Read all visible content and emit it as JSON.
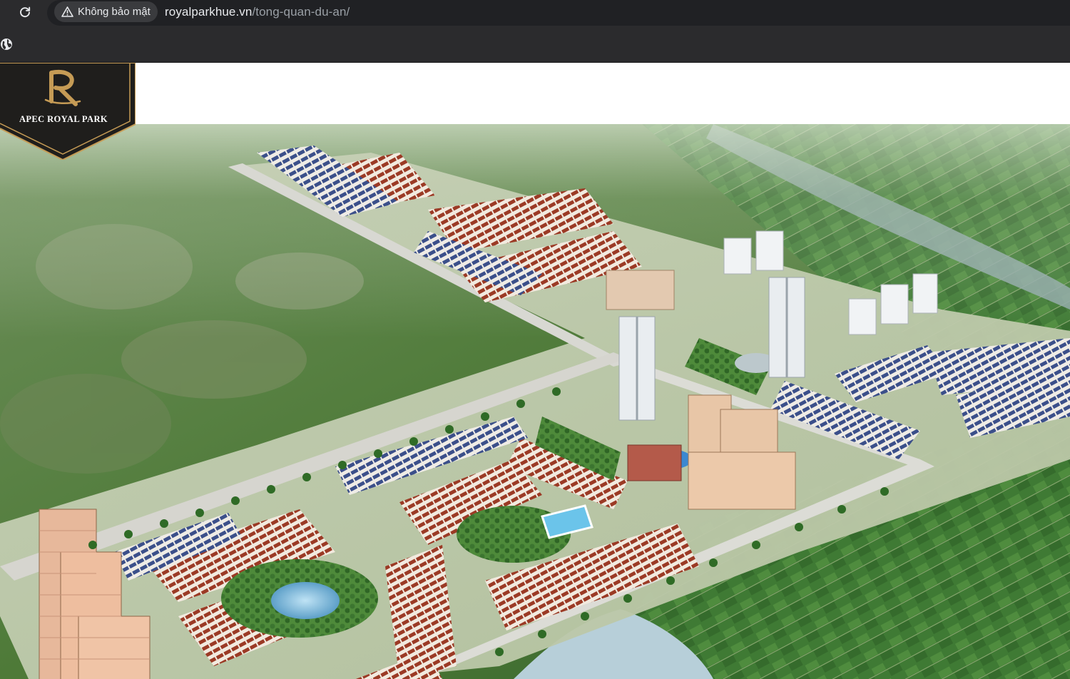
{
  "browser": {
    "security_label": "Không bảo mật",
    "url_domain": "royalparkhue.vn",
    "url_path": "/tong-quan-du-an/",
    "icons": [
      "reload-icon",
      "warning-icon",
      "globe-icon"
    ]
  },
  "site": {
    "logo_text": "APEC ROYAL PARK",
    "colors": {
      "logo_bg": "#1f1e1c",
      "logo_gold": "#c59b55",
      "chrome_bg": "#2b2b2d"
    }
  }
}
